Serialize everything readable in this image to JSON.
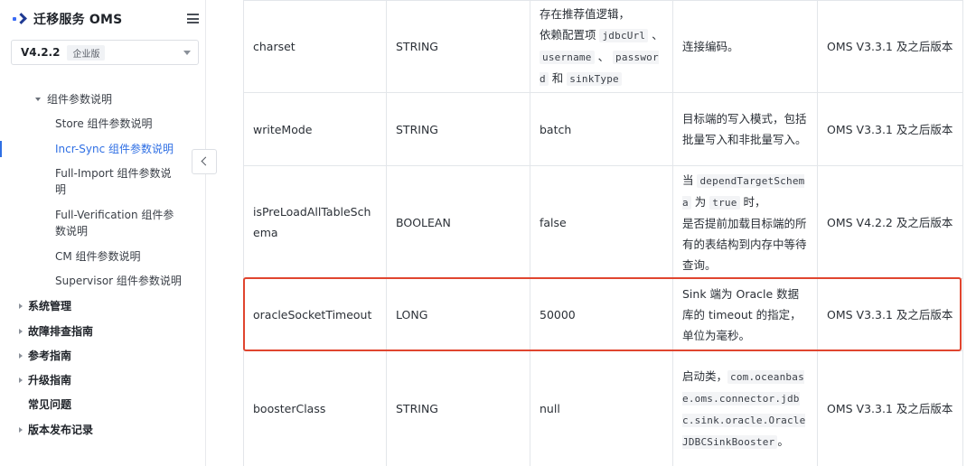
{
  "sidebar": {
    "brand_title": "迁移服务 OMS",
    "version": "V4.2.2",
    "edition": "企业版",
    "nav": [
      {
        "label": "组件参数说明"
      },
      {
        "label": "Store 组件参数说明"
      },
      {
        "label": "Incr-Sync 组件参数说明"
      },
      {
        "label": "Full-Import 组件参数说明"
      },
      {
        "label": "Full-Verification 组件参数说明"
      },
      {
        "label": "CM 组件参数说明"
      },
      {
        "label": "Supervisor 组件参数说明"
      },
      {
        "label": "系统管理"
      },
      {
        "label": "故障排查指南"
      },
      {
        "label": "参考指南"
      },
      {
        "label": "升级指南"
      },
      {
        "label": "常见问题"
      },
      {
        "label": "版本发布记录"
      }
    ]
  },
  "table": {
    "rows": [
      {
        "name": "charset",
        "type": "STRING",
        "default": {
          "text1": "存在推荐值逻辑，",
          "text2": "依赖配置项 ",
          "code1": "jdbcUrl",
          "sep1": " 、 ",
          "code2": "username",
          "sep2": " 、 ",
          "code3": "password",
          "sep3": " 和 ",
          "code4": "sinkType"
        },
        "desc": "连接编码。",
        "version": "OMS V3.3.1 及之后版本"
      },
      {
        "name": "writeMode",
        "type": "STRING",
        "default": "batch",
        "desc": "目标端的写入模式，包括批量写入和非批量写入。",
        "version": "OMS V3.3.1 及之后版本"
      },
      {
        "name": "isPreLoadAllTableSchema",
        "type": "BOOLEAN",
        "default": "false",
        "desc": {
          "text1": "当 ",
          "code1": "dependTargetSchema",
          "text2": " 为 ",
          "code2": "true",
          "text3": " 时，",
          "text4": "是否提前加载目标端的所有的表结构到内存中等待查询。"
        },
        "version": "OMS V4.2.2 及之后版本"
      },
      {
        "name": "oracleSocketTimeout",
        "type": "LONG",
        "default": "50000",
        "desc": "Sink 端为 Oracle 数据库的 timeout 的指定，单位为毫秒。",
        "version": "OMS V3.3.1 及之后版本"
      },
      {
        "name": "boosterClass",
        "type": "STRING",
        "default": "null",
        "desc": {
          "text1": "启动类，",
          "code1": "com.oceanbase.oms.connector.jdbc.sink.oracle.OracleJDBCSinkBooster",
          "text2": "。"
        },
        "version": "OMS V3.3.1 及之后版本"
      }
    ]
  },
  "colors": {
    "accent": "#2f6fe4",
    "highlight_border": "#e0452f"
  }
}
